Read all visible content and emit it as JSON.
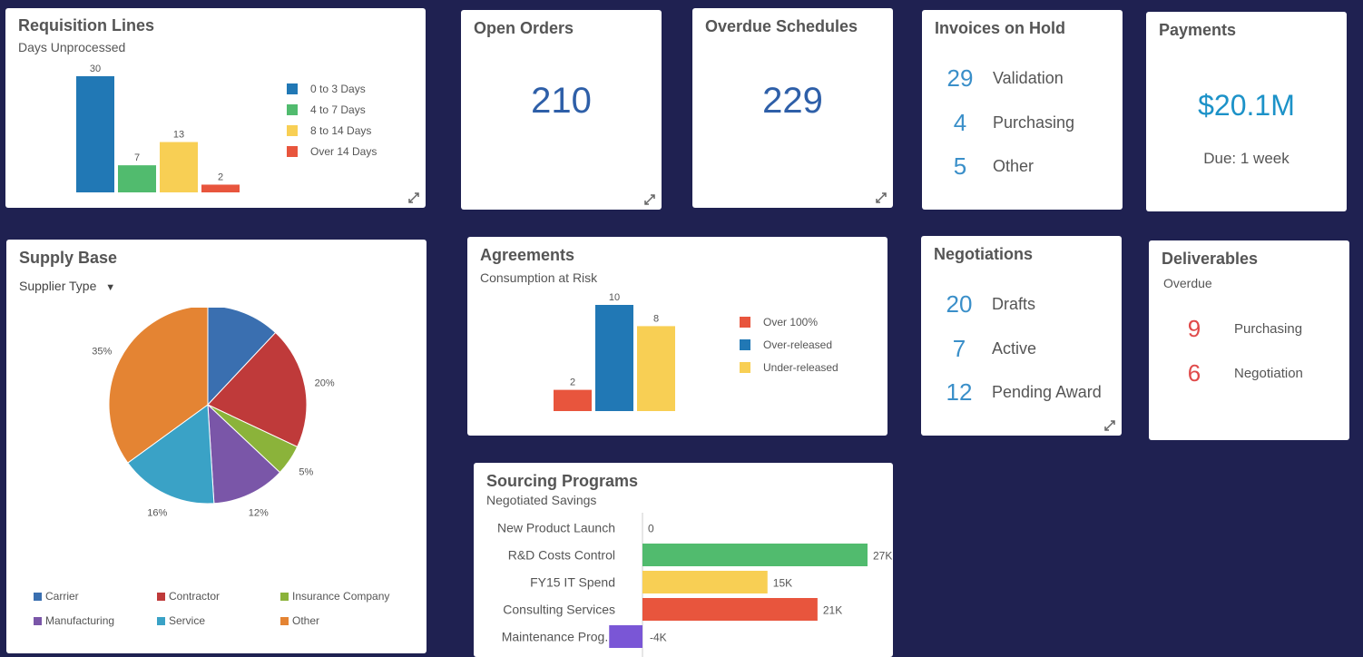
{
  "colors": {
    "blue": "#2178b5",
    "green": "#51bb6e",
    "yellow": "#f8cf54",
    "red": "#e8553d",
    "purple": "#7a56b5",
    "teal": "#3aa2c6",
    "orange": "#e48433",
    "metric_blue": "#3a8fc9",
    "metric_red": "#e04a4a"
  },
  "requisition": {
    "title": "Requisition Lines",
    "subtitle": "Days Unprocessed",
    "legend": [
      "0 to 3 Days",
      "4 to 7 Days",
      "8 to 14 Days",
      "Over 14 Days"
    ]
  },
  "open_orders": {
    "title": "Open Orders",
    "value": "210"
  },
  "overdue": {
    "title": "Overdue Schedules",
    "value": "229"
  },
  "invoices": {
    "title": "Invoices on Hold",
    "rows": [
      {
        "num": "29",
        "label": "Validation"
      },
      {
        "num": "4",
        "label": "Purchasing"
      },
      {
        "num": "5",
        "label": "Other"
      }
    ]
  },
  "payments": {
    "title": "Payments",
    "value": "$20.1M",
    "due": "Due: 1 week"
  },
  "supply": {
    "title": "Supply Base",
    "filter_label": "Supplier Type",
    "legend": [
      "Carrier",
      "Contractor",
      "Insurance Company",
      "Manufacturing",
      "Service",
      "Other"
    ]
  },
  "agreements": {
    "title": "Agreements",
    "subtitle": "Consumption at Risk",
    "legend": [
      "Over 100%",
      "Over-released",
      "Under-released"
    ]
  },
  "negotiations": {
    "title": "Negotiations",
    "rows": [
      {
        "num": "20",
        "label": "Drafts"
      },
      {
        "num": "7",
        "label": "Active"
      },
      {
        "num": "12",
        "label": "Pending Award"
      }
    ]
  },
  "deliverables": {
    "title": "Deliverables",
    "subtitle": "Overdue",
    "rows": [
      {
        "num": "9",
        "label": "Purchasing"
      },
      {
        "num": "6",
        "label": "Negotiation"
      }
    ]
  },
  "sourcing": {
    "title": "Sourcing Programs",
    "subtitle": "Negotiated Savings"
  },
  "chart_data": [
    {
      "type": "bar",
      "title": "Requisition Lines",
      "subtitle": "Days Unprocessed",
      "categories": [
        "0 to 3 Days",
        "4 to 7 Days",
        "8 to 14 Days",
        "Over 14 Days"
      ],
      "values": [
        30,
        7,
        13,
        2
      ],
      "value_labels": [
        "30",
        "7",
        "13",
        "2"
      ],
      "colors": [
        "#2178b5",
        "#51bb6e",
        "#f8cf54",
        "#e8553d"
      ],
      "ylim": [
        0,
        30
      ],
      "legend": "right"
    },
    {
      "type": "pie",
      "title": "Supply Base",
      "categories": [
        "Carrier",
        "Contractor",
        "Insurance Company",
        "Manufacturing",
        "Service",
        "Other"
      ],
      "values": [
        12,
        20,
        5,
        12,
        16,
        35
      ],
      "value_labels": [
        "12%",
        "20%",
        "5%",
        "12%",
        "16%",
        "35%"
      ],
      "colors": [
        "#3a6fb0",
        "#bf3a3a",
        "#8bb33a",
        "#7a56a8",
        "#3aa2c6",
        "#e48433"
      ],
      "legend": "bottom"
    },
    {
      "type": "bar",
      "title": "Agreements",
      "subtitle": "Consumption at Risk",
      "categories": [
        "Over 100%",
        "Over-released",
        "Under-released"
      ],
      "values": [
        2,
        10,
        8
      ],
      "value_labels": [
        "2",
        "10",
        "8"
      ],
      "colors": [
        "#e8553d",
        "#2178b5",
        "#f8cf54"
      ],
      "ylim": [
        0,
        10
      ],
      "legend": "right"
    },
    {
      "type": "bar",
      "orientation": "horizontal",
      "title": "Sourcing Programs",
      "subtitle": "Negotiated Savings",
      "categories": [
        "New Product Launch",
        "R&D Costs Control",
        "FY15 IT Spend",
        "Consulting Services",
        "Maintenance Prog..."
      ],
      "values": [
        0,
        27000,
        15000,
        21000,
        -4000
      ],
      "value_labels": [
        "0",
        "27K",
        "15K",
        "21K",
        "-4K"
      ],
      "colors": [
        "#2178b5",
        "#51bb6e",
        "#f8cf54",
        "#e8553d",
        "#7a56d6"
      ]
    }
  ]
}
